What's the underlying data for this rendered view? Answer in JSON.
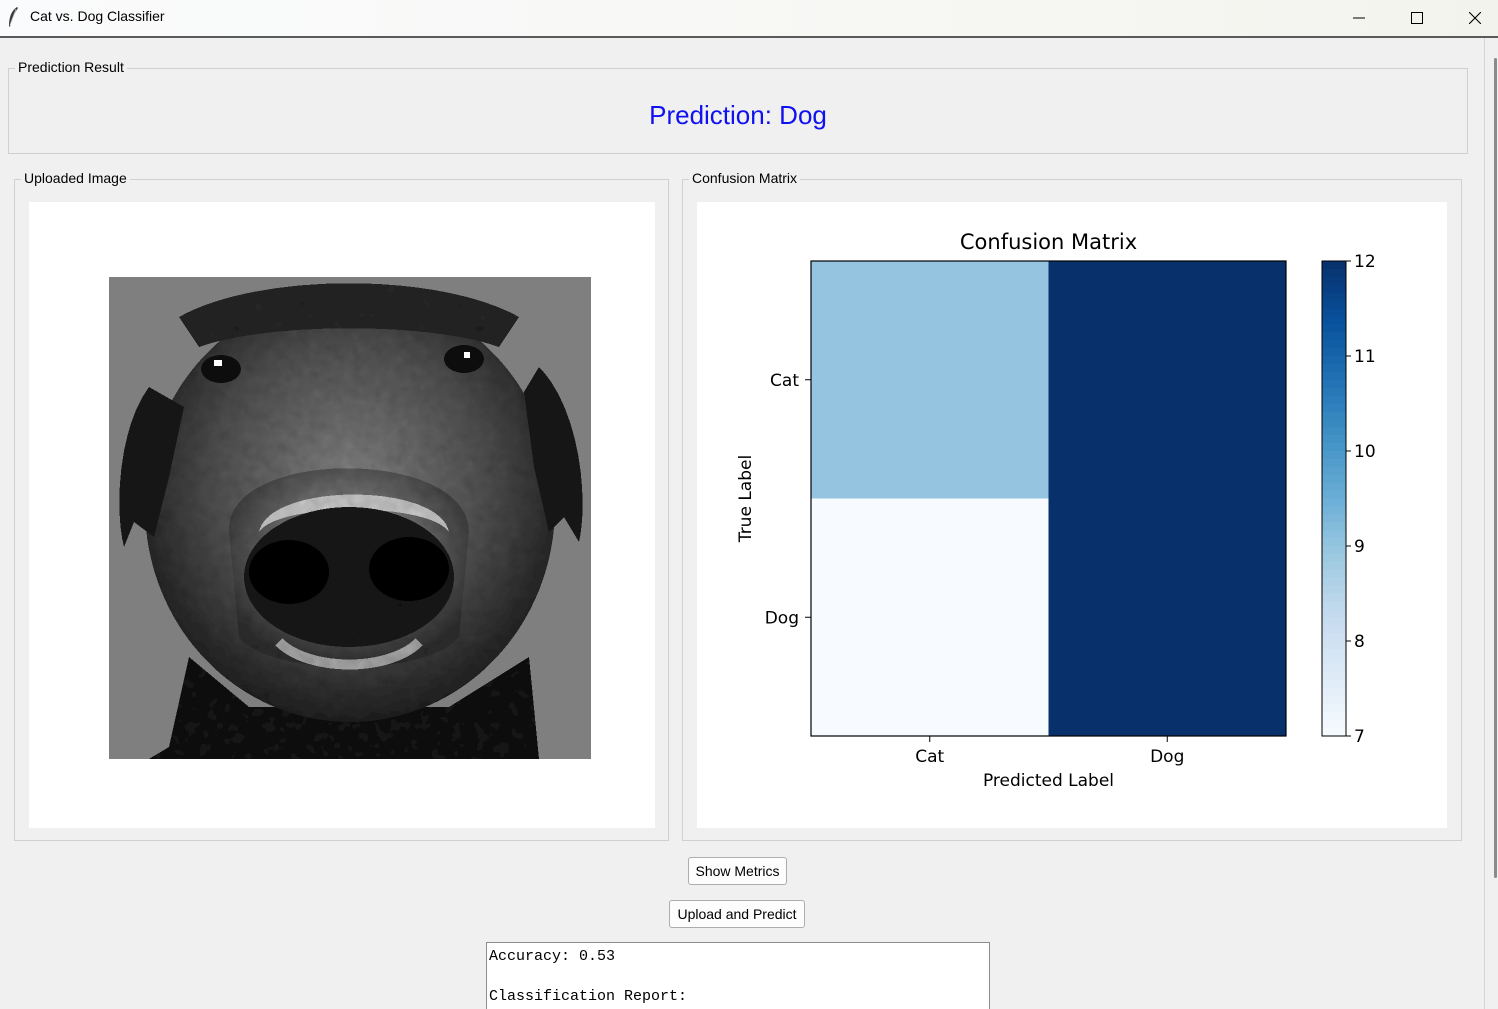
{
  "window": {
    "title": "Cat vs. Dog Classifier"
  },
  "prediction": {
    "frame_label": "Prediction Result",
    "text": "Prediction: Dog",
    "color": "#1010f0"
  },
  "uploaded_image": {
    "frame_label": "Uploaded Image",
    "content": "pixelated grayscale close-up of a black dog's face"
  },
  "confusion_matrix": {
    "frame_label": "Confusion Matrix"
  },
  "chart_data": {
    "type": "heatmap",
    "title": "Confusion Matrix",
    "xlabel": "Predicted Label",
    "ylabel": "True Label",
    "x_categories": [
      "Cat",
      "Dog"
    ],
    "y_categories": [
      "Cat",
      "Dog"
    ],
    "values": [
      [
        9,
        12
      ],
      [
        7,
        12
      ]
    ],
    "colormap": "Blues",
    "colorbar_range": [
      7,
      12
    ],
    "colorbar_ticks": [
      "7",
      "8",
      "9",
      "10",
      "11",
      "12"
    ],
    "annotations": false,
    "grid": false
  },
  "buttons": {
    "show_metrics": "Show Metrics",
    "upload_predict": "Upload and Predict"
  },
  "report": {
    "accuracy_line": "Accuracy: 0.53",
    "report_heading": "Classification Report:"
  }
}
